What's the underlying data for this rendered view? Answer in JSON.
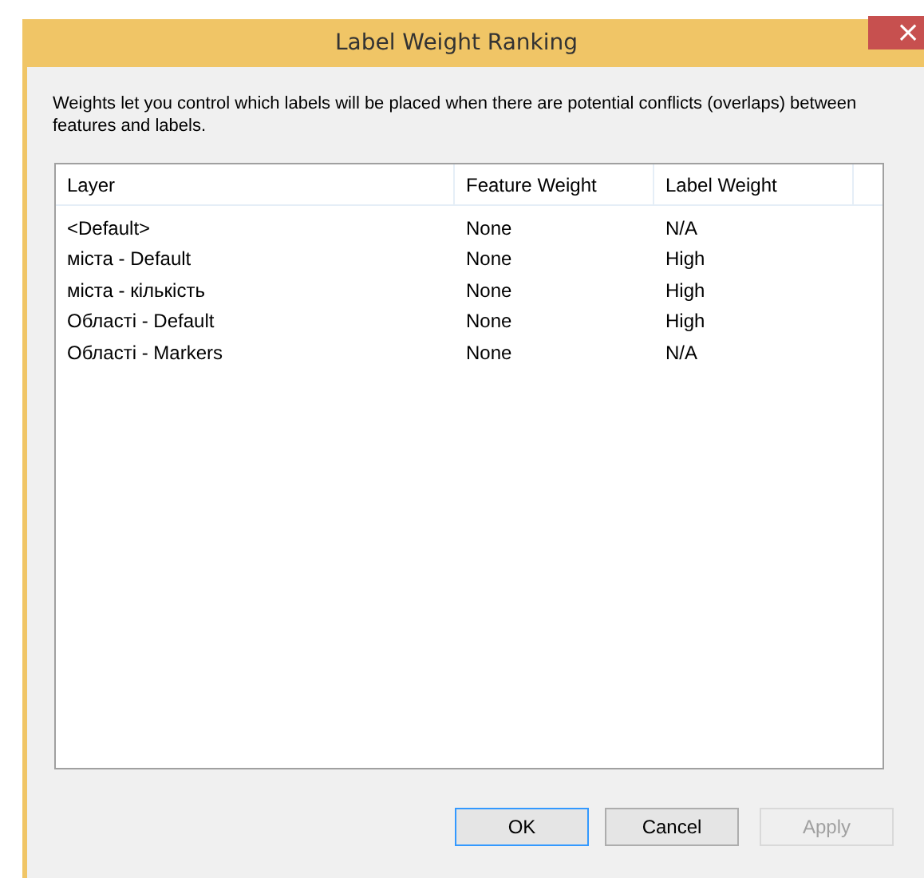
{
  "window": {
    "title": "Label Weight Ranking",
    "close": "×"
  },
  "description": "Weights let you control which labels will be placed when there are potential conflicts (overlaps) between features and labels.",
  "table": {
    "columns": [
      "Layer",
      "Feature Weight",
      "Label Weight"
    ],
    "rows": [
      {
        "cells": [
          "<Default>",
          "None",
          "N/A"
        ]
      },
      {
        "cells": [
          "міста - Default",
          "None",
          "High"
        ]
      },
      {
        "cells": [
          "міста - кількість",
          "None",
          "High"
        ]
      },
      {
        "cells": [
          "Області - Default",
          "None",
          "High"
        ]
      },
      {
        "cells": [
          "Області - Markers",
          "None",
          "N/A"
        ]
      }
    ]
  },
  "buttons": [
    {
      "label": "OK",
      "kind": "default",
      "disabled": false
    },
    {
      "label": "Cancel",
      "kind": "normal",
      "disabled": false
    },
    {
      "label": "Apply",
      "kind": "normal",
      "disabled": true
    }
  ]
}
